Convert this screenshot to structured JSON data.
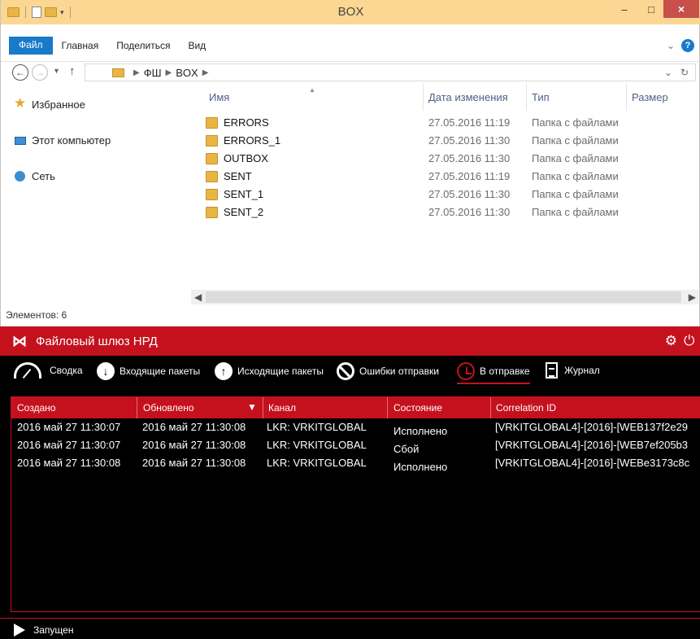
{
  "explorer": {
    "title": "BOX",
    "window_controls": {
      "minimize": "–",
      "maximize": "□",
      "close": "×"
    },
    "ribbon_tabs": [
      "Файл",
      "Главная",
      "Поделиться",
      "Вид"
    ],
    "address": {
      "crumbs": [
        "ФШ",
        "BOX"
      ]
    },
    "nav_pane": [
      "Избранное",
      "Этот компьютер",
      "Сеть"
    ],
    "columns": {
      "name": "Имя",
      "date": "Дата изменения",
      "type": "Тип",
      "size": "Размер"
    },
    "rows": [
      {
        "name": "ERRORS",
        "date": "27.05.2016 11:19",
        "type": "Папка с файлами"
      },
      {
        "name": "ERRORS_1",
        "date": "27.05.2016 11:30",
        "type": "Папка с файлами"
      },
      {
        "name": "OUTBOX",
        "date": "27.05.2016 11:30",
        "type": "Папка с файлами"
      },
      {
        "name": "SENT",
        "date": "27.05.2016 11:19",
        "type": "Папка с файлами"
      },
      {
        "name": "SENT_1",
        "date": "27.05.2016 11:30",
        "type": "Папка с файлами"
      },
      {
        "name": "SENT_2",
        "date": "27.05.2016 11:30",
        "type": "Папка с файлами"
      }
    ],
    "status": "Элементов: 6"
  },
  "nrd": {
    "title": "Файловый шлюз НРД",
    "toolbar": {
      "summary": "Сводка",
      "incoming": "Входящие пакеты",
      "outgoing": "Исходящие пакеты",
      "errors": "Ошибки отправки",
      "sending": "В отправке",
      "journal": "Журнал"
    },
    "columns": {
      "created": "Создано",
      "updated": "Обновлено",
      "channel": "Канал",
      "state": "Состояние",
      "correlation": "Correlation ID"
    },
    "rows": [
      {
        "created": "2016 май 27 11:30:07",
        "updated": "2016 май 27 11:30:08",
        "channel": "LKR: VRKITGLOBAL",
        "state": "Исполнено",
        "correlation": "[VRKITGLOBAL4]-[2016]-[WEB137f2e29"
      },
      {
        "created": "2016 май 27 11:30:07",
        "updated": "2016 май 27 11:30:08",
        "channel": "LKR: VRKITGLOBAL",
        "state": "Сбой",
        "correlation": "[VRKITGLOBAL4]-[2016]-[WEB7ef205b3"
      },
      {
        "created": "2016 май 27 11:30:08",
        "updated": "2016 май 27 11:30:08",
        "channel": "LKR: VRKITGLOBAL",
        "state": "Исполнено",
        "correlation": "[VRKITGLOBAL4]-[2016]-[WEBe3173c8c"
      }
    ],
    "status": "Запущен"
  }
}
